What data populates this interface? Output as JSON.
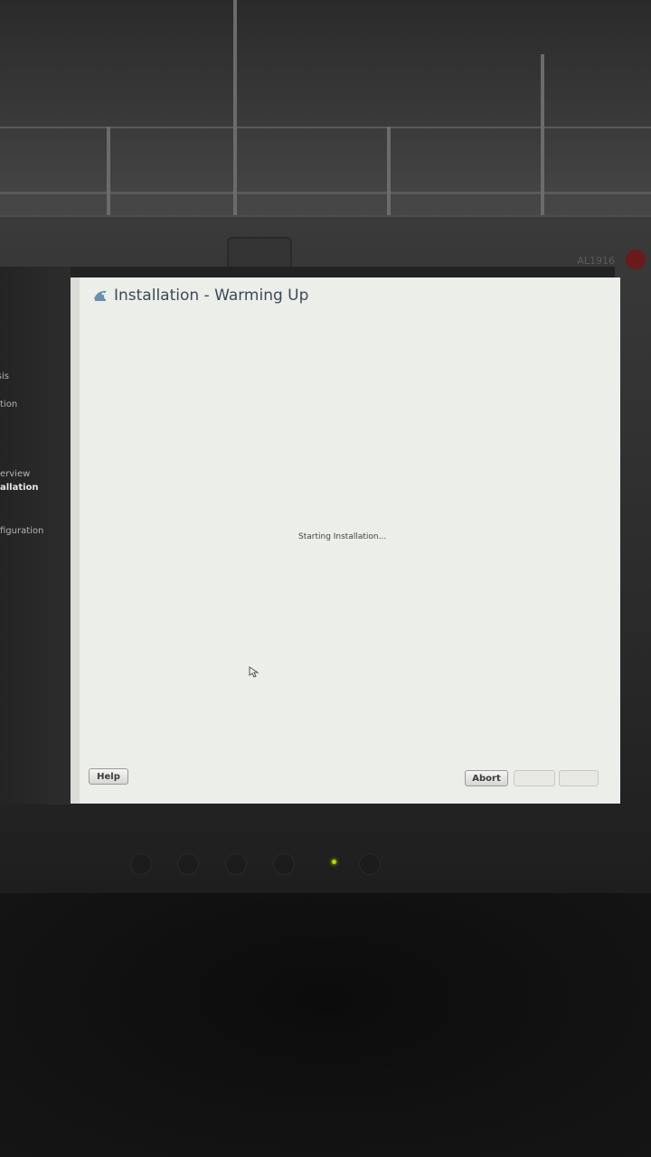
{
  "installer": {
    "title": "Installation - Warming Up",
    "status": "Starting Installation...",
    "buttons": {
      "help": "Help",
      "abort": "Abort",
      "back": "",
      "next": ""
    }
  },
  "sidebar": {
    "items": [
      "sis",
      "tion",
      "erview",
      "allation",
      "figuration"
    ],
    "active_index": 3
  },
  "monitor": {
    "model": "AL1916"
  },
  "colors": {
    "installer_background": "#eceeea",
    "title_text": "#3b4a5a",
    "sidebar_background": "#262626",
    "power_led": "#b6d300"
  },
  "icons": {
    "title": "chameleon-logo-icon",
    "pointer": "mouse-pointer-icon"
  }
}
